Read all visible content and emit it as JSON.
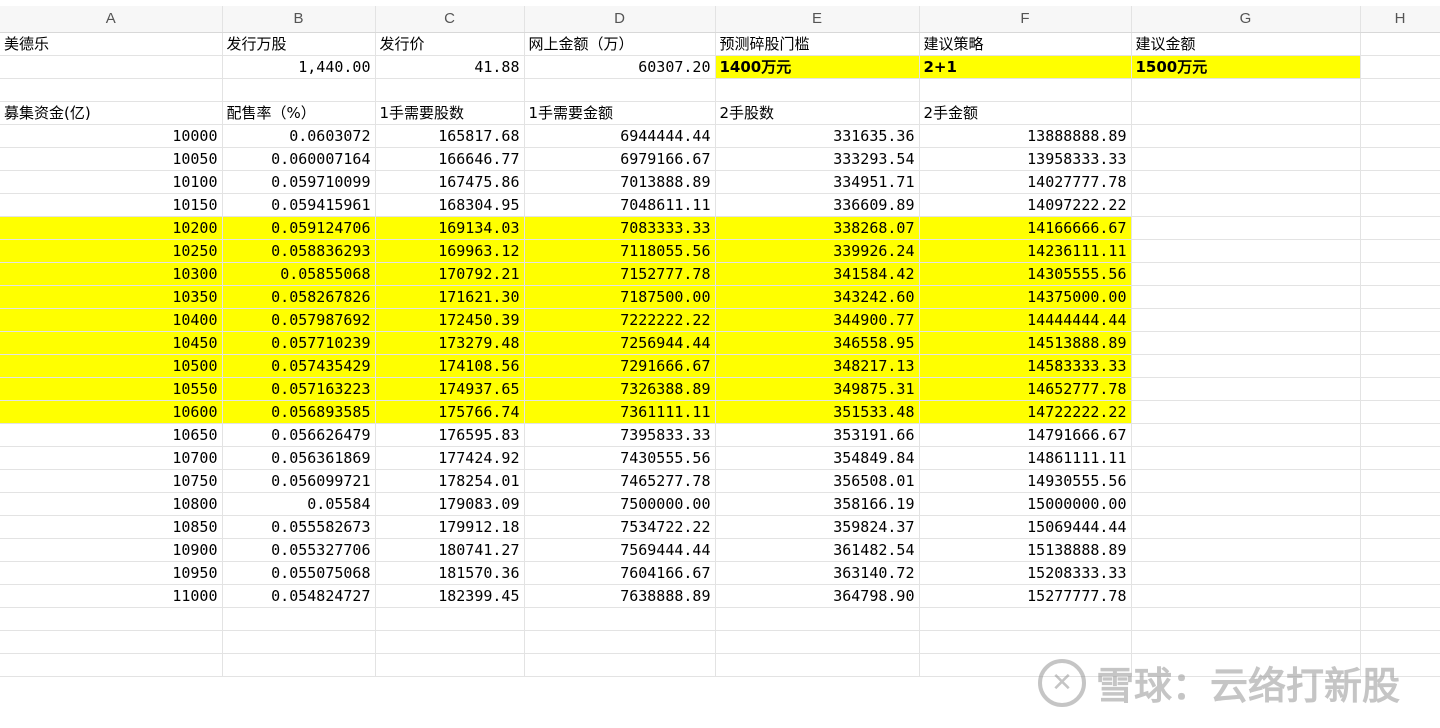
{
  "columns": [
    "A",
    "B",
    "C",
    "D",
    "E",
    "F",
    "G",
    "H"
  ],
  "header_row": {
    "a": "美德乐",
    "b": "发行万股",
    "c": "发行价",
    "d": "网上金额（万）",
    "e": "预测碎股门槛",
    "f": "建议策略",
    "g": "建议金额"
  },
  "values_row": {
    "b": "1,440.00",
    "c": "41.88",
    "d": "60307.20",
    "e": "1400万元",
    "f": "2+1",
    "g": "1500万元"
  },
  "table_header": {
    "a": "募集资金(亿)",
    "b": "配售率（%）",
    "c": "1手需要股数",
    "d": "1手需要金额",
    "e": "2手股数",
    "f": "2手金额"
  },
  "rows": [
    {
      "a": "10000",
      "b": "0.0603072",
      "c": "165817.68",
      "d": "6944444.44",
      "e": "331635.36",
      "f": "13888888.89"
    },
    {
      "a": "10050",
      "b": "0.060007164",
      "c": "166646.77",
      "d": "6979166.67",
      "e": "333293.54",
      "f": "13958333.33"
    },
    {
      "a": "10100",
      "b": "0.059710099",
      "c": "167475.86",
      "d": "7013888.89",
      "e": "334951.71",
      "f": "14027777.78"
    },
    {
      "a": "10150",
      "b": "0.059415961",
      "c": "168304.95",
      "d": "7048611.11",
      "e": "336609.89",
      "f": "14097222.22"
    },
    {
      "a": "10200",
      "b": "0.059124706",
      "c": "169134.03",
      "d": "7083333.33",
      "e": "338268.07",
      "f": "14166666.67"
    },
    {
      "a": "10250",
      "b": "0.058836293",
      "c": "169963.12",
      "d": "7118055.56",
      "e": "339926.24",
      "f": "14236111.11"
    },
    {
      "a": "10300",
      "b": "0.05855068",
      "c": "170792.21",
      "d": "7152777.78",
      "e": "341584.42",
      "f": "14305555.56"
    },
    {
      "a": "10350",
      "b": "0.058267826",
      "c": "171621.30",
      "d": "7187500.00",
      "e": "343242.60",
      "f": "14375000.00"
    },
    {
      "a": "10400",
      "b": "0.057987692",
      "c": "172450.39",
      "d": "7222222.22",
      "e": "344900.77",
      "f": "14444444.44"
    },
    {
      "a": "10450",
      "b": "0.057710239",
      "c": "173279.48",
      "d": "7256944.44",
      "e": "346558.95",
      "f": "14513888.89"
    },
    {
      "a": "10500",
      "b": "0.057435429",
      "c": "174108.56",
      "d": "7291666.67",
      "e": "348217.13",
      "f": "14583333.33"
    },
    {
      "a": "10550",
      "b": "0.057163223",
      "c": "174937.65",
      "d": "7326388.89",
      "e": "349875.31",
      "f": "14652777.78"
    },
    {
      "a": "10600",
      "b": "0.056893585",
      "c": "175766.74",
      "d": "7361111.11",
      "e": "351533.48",
      "f": "14722222.22"
    },
    {
      "a": "10650",
      "b": "0.056626479",
      "c": "176595.83",
      "d": "7395833.33",
      "e": "353191.66",
      "f": "14791666.67"
    },
    {
      "a": "10700",
      "b": "0.056361869",
      "c": "177424.92",
      "d": "7430555.56",
      "e": "354849.84",
      "f": "14861111.11"
    },
    {
      "a": "10750",
      "b": "0.056099721",
      "c": "178254.01",
      "d": "7465277.78",
      "e": "356508.01",
      "f": "14930555.56"
    },
    {
      "a": "10800",
      "b": "0.05584",
      "c": "179083.09",
      "d": "7500000.00",
      "e": "358166.19",
      "f": "15000000.00"
    },
    {
      "a": "10850",
      "b": "0.055582673",
      "c": "179912.18",
      "d": "7534722.22",
      "e": "359824.37",
      "f": "15069444.44"
    },
    {
      "a": "10900",
      "b": "0.055327706",
      "c": "180741.27",
      "d": "7569444.44",
      "e": "361482.54",
      "f": "15138888.89"
    },
    {
      "a": "10950",
      "b": "0.055075068",
      "c": "181570.36",
      "d": "7604166.67",
      "e": "363140.72",
      "f": "15208333.33"
    },
    {
      "a": "11000",
      "b": "0.054824727",
      "c": "182399.45",
      "d": "7638888.89",
      "e": "364798.90",
      "f": "15277777.78"
    }
  ],
  "highlight_rows": [
    4,
    5,
    6,
    7,
    8,
    9,
    10,
    11,
    12
  ],
  "highlight_color": "#ffff00",
  "watermark": {
    "logo_icon": "xueqiu-logo-icon",
    "text": "雪球：云络打新股"
  }
}
